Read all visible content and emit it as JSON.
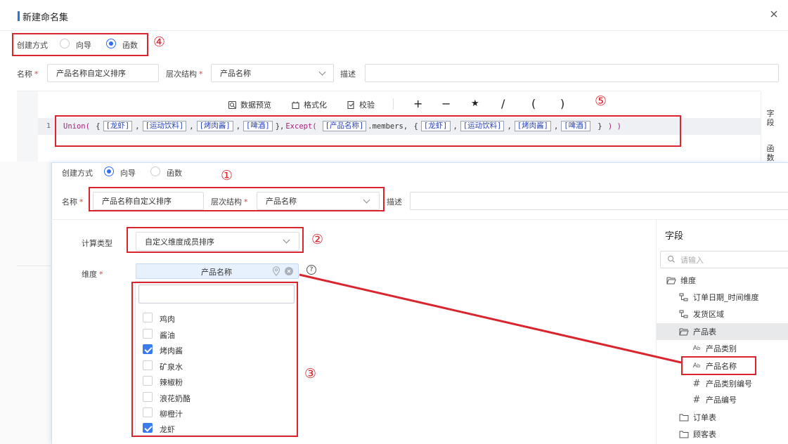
{
  "dialog": {
    "title": "新建命名集",
    "close_icon": "close-icon"
  },
  "outer": {
    "create_mode_label": "创建方式",
    "mode_wizard": "向导",
    "mode_function": "函数",
    "selected_mode": "函数",
    "name_label": "名称",
    "name_value": "产品名称自定义排序",
    "hierarchy_label": "层次结构",
    "hierarchy_value": "产品名称",
    "desc_label": "描述",
    "desc_value": "",
    "toolbar": {
      "preview": "数据预览",
      "format": "格式化",
      "validate": "校验",
      "operators": [
        "+",
        "−",
        "★",
        "/",
        "(",
        ")"
      ]
    },
    "line_number": "1",
    "code": {
      "union": "Union(",
      "union_members": [
        "[龙虾]",
        "[运动饮料]",
        "[烤肉酱]",
        "[啤酒]"
      ],
      "except": "Except(",
      "except_ref": "[产品名称]",
      "members_suffix": ".members,",
      "except_members": [
        "[龙虾]",
        "[运动饮料]",
        "[烤肉酱]",
        "[啤酒]"
      ]
    },
    "side_tabs": [
      "字段",
      "函数"
    ]
  },
  "inner": {
    "create_mode_label": "创建方式",
    "mode_wizard": "向导",
    "mode_function": "函数",
    "selected_mode": "向导",
    "name_label": "名称",
    "name_value": "产品名称自定义排序",
    "hierarchy_label": "层次结构",
    "hierarchy_value": "产品名称",
    "desc_label": "描述",
    "calc_type_label": "计算类型",
    "calc_type_value": "自定义维度成员排序",
    "dimension_label": "维度",
    "dimension_tag": "产品名称",
    "search_value": "",
    "members": [
      {
        "label": "鸡肉",
        "checked": false
      },
      {
        "label": "酱油",
        "checked": false
      },
      {
        "label": "烤肉酱",
        "checked": true
      },
      {
        "label": "矿泉水",
        "checked": false
      },
      {
        "label": "辣椒粉",
        "checked": false
      },
      {
        "label": "浪花奶酪",
        "checked": false
      },
      {
        "label": "柳橙汁",
        "checked": false
      },
      {
        "label": "龙虾",
        "checked": true
      }
    ],
    "fields_panel": {
      "title": "字段",
      "search_placeholder": "请输入",
      "tree": [
        {
          "label": "维度",
          "icon": "folder-open-icon",
          "level": 0
        },
        {
          "label": "订单日期_时间维度",
          "icon": "hierarchy-icon",
          "level": 1
        },
        {
          "label": "发货区域",
          "icon": "hierarchy-icon",
          "level": 1
        },
        {
          "label": "产品表",
          "icon": "folder-open-icon",
          "level": 1,
          "selected": true
        },
        {
          "label": "产品类别",
          "icon": "text-field-icon",
          "level": 2
        },
        {
          "label": "产品名称",
          "icon": "text-field-icon",
          "level": 2,
          "highlighted": true
        },
        {
          "label": "产品类别编号",
          "icon": "number-field-icon",
          "level": 2
        },
        {
          "label": "产品编号",
          "icon": "number-field-icon",
          "level": 2
        },
        {
          "label": "订单表",
          "icon": "folder-icon",
          "level": 1
        },
        {
          "label": "顾客表",
          "icon": "folder-icon",
          "level": 1
        }
      ]
    }
  },
  "annotations": [
    "①",
    "②",
    "③",
    "④",
    "⑤"
  ],
  "colors": {
    "accent": "#2f6fed",
    "annotation_red": "#d9252e",
    "title_bar": "#2f6fed"
  }
}
